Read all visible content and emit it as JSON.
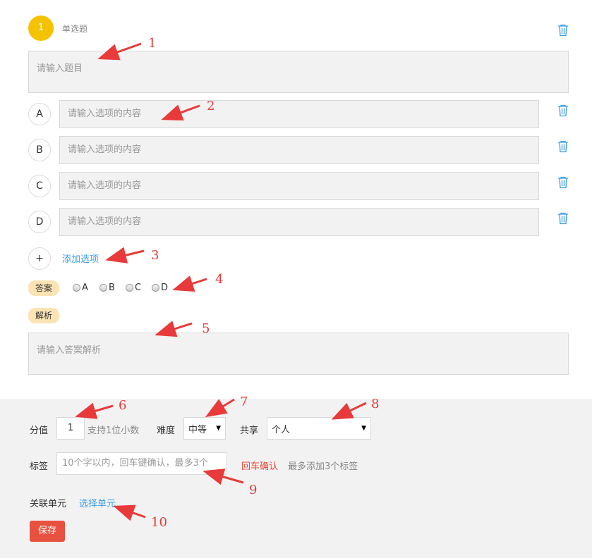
{
  "question": {
    "number": "1",
    "type_label": "单选题",
    "title_placeholder": "请输入题目",
    "delete_icon": "trash-icon"
  },
  "options": [
    {
      "letter": "A",
      "placeholder": "请输入选项的内容"
    },
    {
      "letter": "B",
      "placeholder": "请输入选项的内容"
    },
    {
      "letter": "C",
      "placeholder": "请输入选项的内容"
    },
    {
      "letter": "D",
      "placeholder": "请输入选项的内容"
    }
  ],
  "add_option": {
    "symbol": "+",
    "label": "添加选项"
  },
  "answer": {
    "badge": "答案",
    "choices": [
      "A",
      "B",
      "C",
      "D"
    ]
  },
  "analysis": {
    "badge": "解析",
    "placeholder": "请输入答案解析"
  },
  "settings": {
    "score_label": "分值",
    "score_value": "1",
    "score_hint": "支持1位小数",
    "difficulty_label": "难度",
    "difficulty_value": "中等",
    "share_label": "共享",
    "share_value": "个人",
    "tags_label": "标签",
    "tags_placeholder": "10个字以内，回车键确认，最多3个",
    "tags_confirm": "回车确认",
    "tags_hint": "最多添加3个标签",
    "unit_label": "关联单元",
    "unit_link": "选择单元",
    "save_label": "保存"
  },
  "callouts": [
    "1",
    "2",
    "3",
    "4",
    "5",
    "6",
    "7",
    "8",
    "9",
    "10"
  ],
  "colors": {
    "accent_yellow": "#f5c200",
    "link_blue": "#3d9ee3",
    "save_red": "#e85040",
    "confirm_red": "#e84a3a",
    "badge_bg": "#fbe3b4",
    "arrow_red": "#e83a3a"
  }
}
